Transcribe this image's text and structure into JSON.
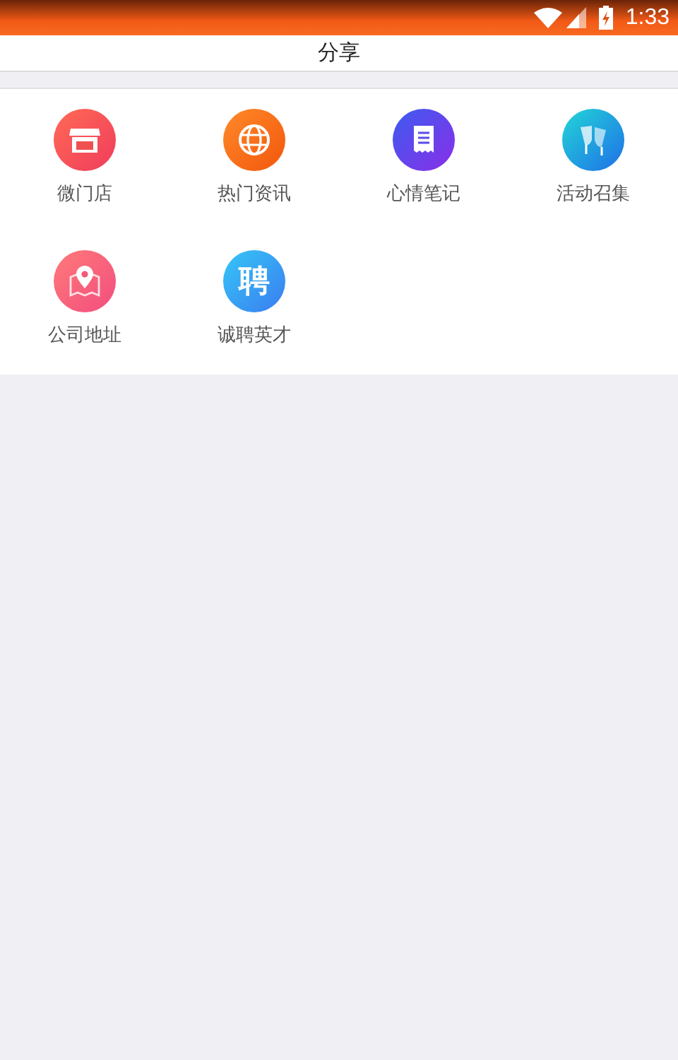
{
  "status_bar": {
    "time": "1:33"
  },
  "header": {
    "title": "分享"
  },
  "share_items": [
    {
      "kind": "store",
      "label": "微门店"
    },
    {
      "kind": "globe",
      "label": "热门资讯"
    },
    {
      "kind": "note",
      "label": "心情笔记"
    },
    {
      "kind": "glasses",
      "label": "活动召集"
    },
    {
      "kind": "map",
      "label": "公司地址"
    },
    {
      "kind": "glyph",
      "glyph": "聘",
      "label": "诚聘英才"
    }
  ]
}
